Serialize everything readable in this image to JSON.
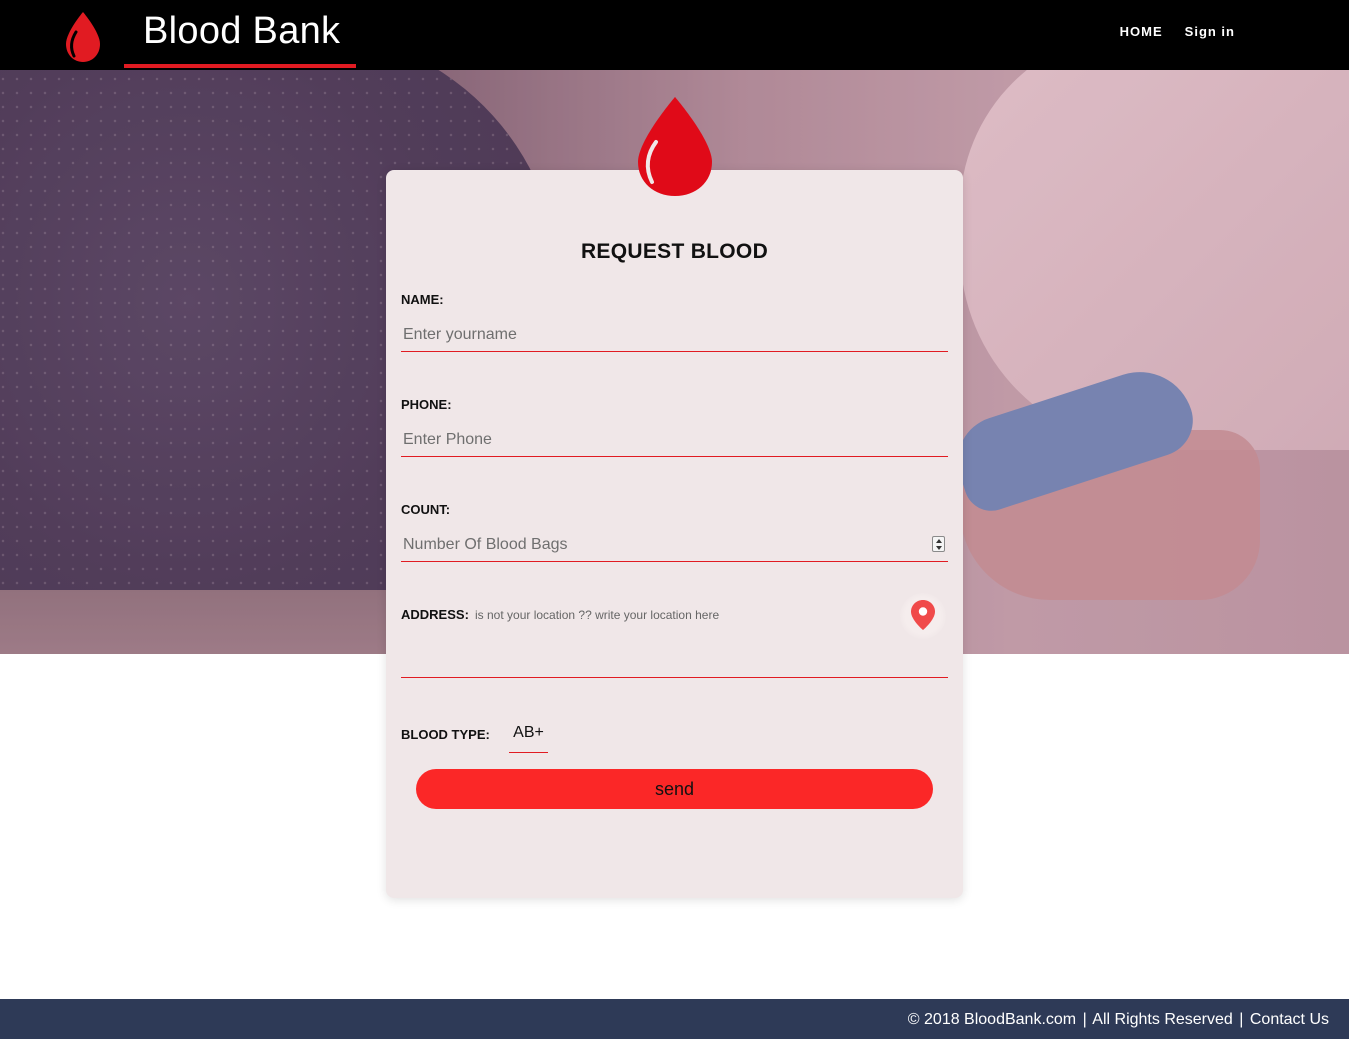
{
  "header": {
    "brand": "Blood Bank",
    "nav": [
      {
        "label": "HOME"
      },
      {
        "label": "Sign in"
      }
    ]
  },
  "form": {
    "title": "REQUEST BLOOD",
    "name": {
      "label": "NAME:",
      "placeholder": "Enter yourname"
    },
    "phone": {
      "label": "PHONE:",
      "placeholder": "Enter Phone"
    },
    "count": {
      "label": "COUNT:",
      "placeholder": "Number Of Blood Bags"
    },
    "address": {
      "label": "ADDRESS:",
      "hint": "is not your location ?? write your location here"
    },
    "blood_type": {
      "label": "BLOOD TYPE:",
      "value": "AB+"
    },
    "submit_label": "send"
  },
  "footer": {
    "copyright": "© 2018 BloodBank.com",
    "rights": "All Rights Reserved",
    "separator": "|",
    "contact": "Contact Us"
  },
  "colors": {
    "accent_red": "#e11b22",
    "button_red": "#fb2727",
    "header_bg": "#000000",
    "footer_bg": "#2e3a57",
    "card_bg": "#f0e7e8"
  },
  "icons": [
    "blood-drop-icon",
    "map-pin-icon"
  ]
}
